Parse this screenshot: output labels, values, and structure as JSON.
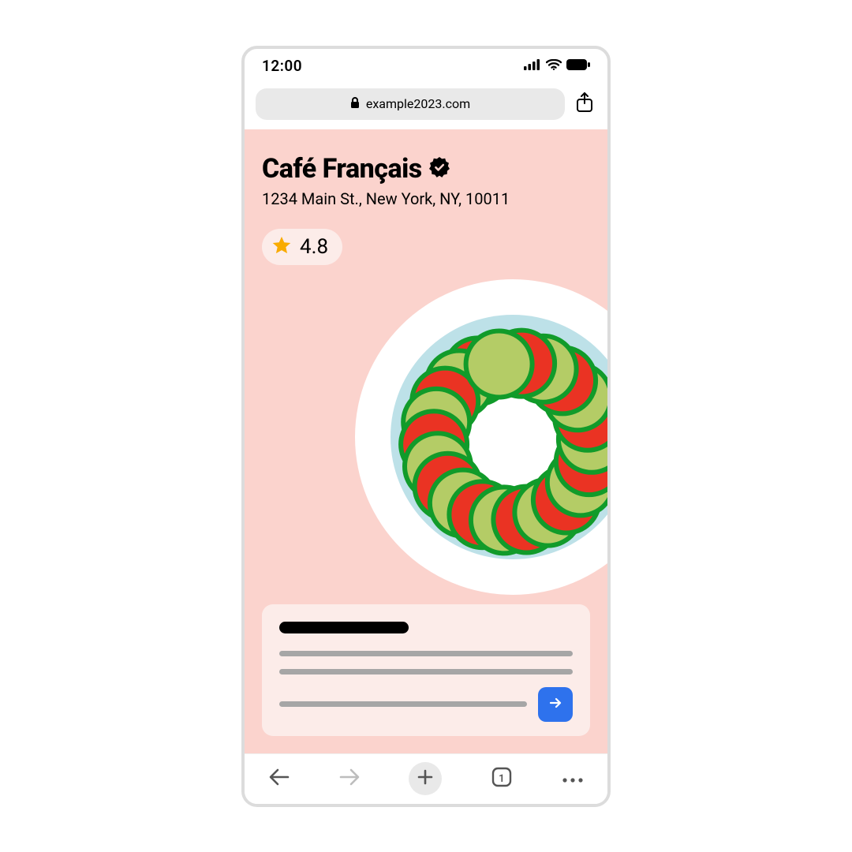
{
  "status": {
    "time": "12:00"
  },
  "url": "example2023.com",
  "page": {
    "title": "Café Français",
    "address": "1234 Main St., New York, NY, 10011",
    "rating": "4.8"
  },
  "nav": {
    "tab_count": "1"
  }
}
